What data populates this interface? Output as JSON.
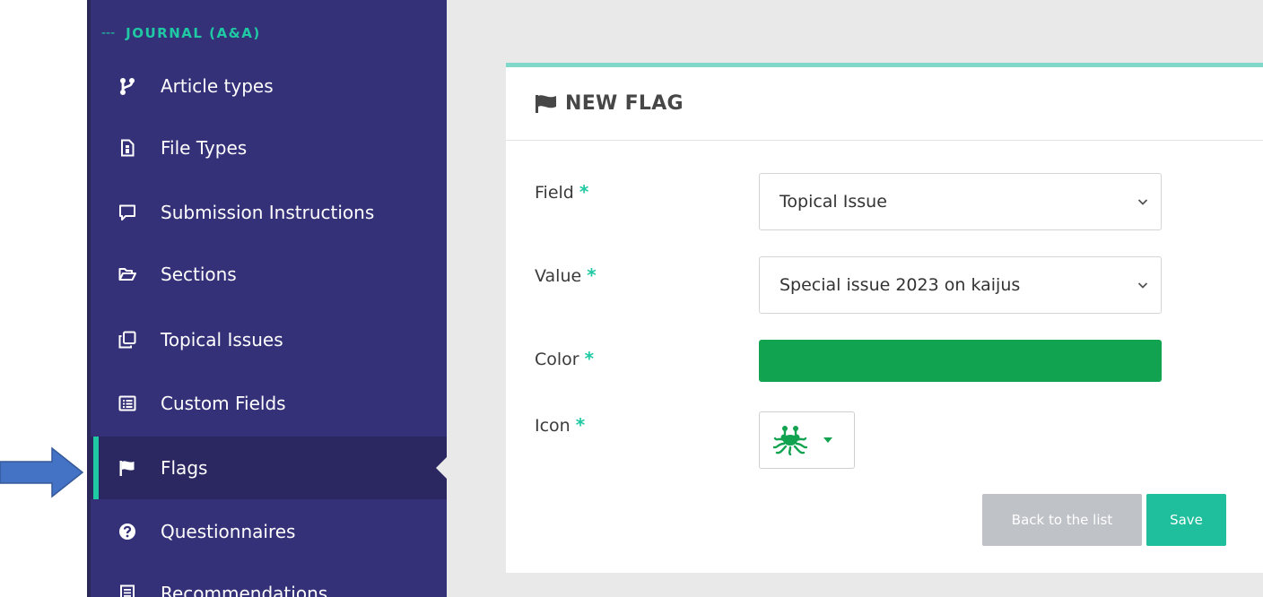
{
  "sidebar": {
    "section_dash": "---",
    "section_title": "JOURNAL (A&A)",
    "items": [
      {
        "label": "Article types",
        "icon": "code-branch-icon"
      },
      {
        "label": "File Types",
        "icon": "file-icon"
      },
      {
        "label": "Submission Instructions",
        "icon": "comment-icon"
      },
      {
        "label": "Sections",
        "icon": "folder-open-icon"
      },
      {
        "label": "Topical Issues",
        "icon": "clone-icon"
      },
      {
        "label": "Custom Fields",
        "icon": "list-alt-icon"
      },
      {
        "label": "Flags",
        "icon": "flag-icon",
        "active": true
      },
      {
        "label": "Questionnaires",
        "icon": "question-circle-icon"
      },
      {
        "label": "Recommendations",
        "icon": "document-icon"
      }
    ]
  },
  "form": {
    "title": "NEW FLAG",
    "required_marker": "*",
    "field_label": "Field",
    "field_value": "Topical Issue",
    "value_label": "Value",
    "value_value": "Special issue 2023 on kaijus",
    "color_label": "Color",
    "color_value": "#12a350",
    "icon_label": "Icon",
    "icon_value": "flying-spaghetti-monster-icon",
    "back_button": "Back to the list",
    "save_button": "Save"
  },
  "colors": {
    "sidebar_bg": "#353179",
    "accent": "#1fc9a3",
    "card_border": "#80d9c8",
    "annotation_arrow": "#4472c4"
  }
}
